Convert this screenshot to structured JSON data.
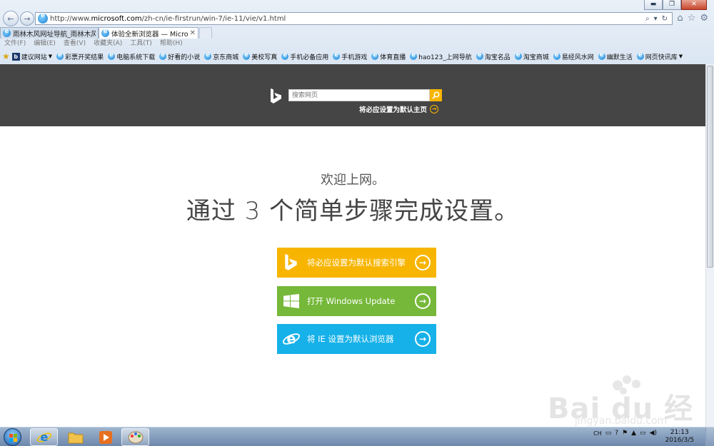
{
  "window": {
    "minimize": "▬",
    "maximize": "❐",
    "close": "✕"
  },
  "address_bar": {
    "url_prefix": "http://www.",
    "url_domain": "microsoft.com",
    "url_path": "/zh-cn/ie-firstrun/win-7/ie-11/vie/v1.html",
    "search_glyph": "⌕",
    "dropdown_glyph": "▾",
    "refresh_glyph": "↻"
  },
  "toolbar_icons": {
    "home": "⌂",
    "favorites": "☆",
    "settings": "⚙"
  },
  "tabs": [
    {
      "label": "雨林木风网址导航_雨林木风_...",
      "close": ""
    },
    {
      "label": "体验全新浏览器 — Micros...",
      "close": "✕"
    }
  ],
  "menu": [
    "文件(F)",
    "编辑(E)",
    "查看(V)",
    "收藏夹(A)",
    "工具(T)",
    "帮助(H)"
  ],
  "favorites_bar": [
    {
      "label": "建议网站",
      "type": "bing",
      "caret": "▼"
    },
    {
      "label": "彩票开奖结果",
      "type": "ie"
    },
    {
      "label": "电脑系统下载",
      "type": "ie"
    },
    {
      "label": "好看的小说",
      "type": "ie"
    },
    {
      "label": "京东商城",
      "type": "ie"
    },
    {
      "label": "美校写真",
      "type": "ie"
    },
    {
      "label": "手机必备应用",
      "type": "ie"
    },
    {
      "label": "手机游戏",
      "type": "ie"
    },
    {
      "label": "体育直播",
      "type": "ie"
    },
    {
      "label": "hao123_上网导航",
      "type": "ie"
    },
    {
      "label": "淘宝名品",
      "type": "ie"
    },
    {
      "label": "淘宝商城",
      "type": "ie"
    },
    {
      "label": "易经风水网",
      "type": "ie"
    },
    {
      "label": "幽默生活",
      "type": "ie"
    },
    {
      "label": "网页快讯库",
      "type": "ie",
      "caret": "▼"
    }
  ],
  "bing": {
    "search_placeholder": "搜索网页",
    "set_home_label": "将必应设置为默认主页",
    "set_home_arrow": "→"
  },
  "welcome": {
    "greeting": "欢迎上网。",
    "headline": "通过 3 个简单步骤完成设置。"
  },
  "steps": [
    {
      "label": "将必应设置为默认搜索引擎",
      "color": "#f8b500",
      "icon": "bing-logo-icon",
      "arrow": "→"
    },
    {
      "label": "打开 Windows Update",
      "color": "#76b83a",
      "icon": "windows-logo-icon",
      "arrow": "→"
    },
    {
      "label": "将 IE 设置为默认浏览器",
      "color": "#16b1e8",
      "icon": "ie-logo-icon",
      "arrow": "→"
    }
  ],
  "watermark": {
    "main": "Bai du 经验",
    "sub": "jingyan.baidu.com"
  },
  "taskbar": {
    "tray_lang": "CH",
    "tray_glyphs": [
      "▭",
      "?",
      "⚑",
      "▲",
      "▭",
      "◀)"
    ],
    "time": "21:13",
    "date": "2016/3/5"
  }
}
